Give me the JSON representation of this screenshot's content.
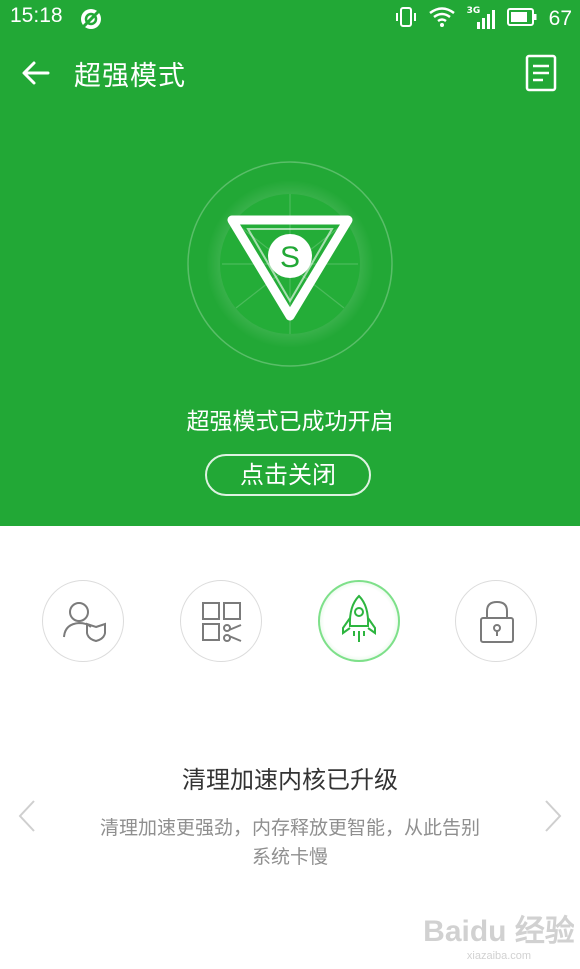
{
  "status_bar": {
    "time": "15:18",
    "network": "3G",
    "battery": "67"
  },
  "header": {
    "title": "超强模式"
  },
  "hero": {
    "logo_letter": "S",
    "status_text": "超强模式已成功开启",
    "close_button_label": "点击关闭"
  },
  "features": [
    {
      "icon": "user-shield-icon",
      "active": false
    },
    {
      "icon": "app-manager-icon",
      "active": false
    },
    {
      "icon": "rocket-icon",
      "active": true
    },
    {
      "icon": "lock-icon",
      "active": false
    }
  ],
  "feature_detail": {
    "headline": "清理加速内核已升级",
    "description": "清理加速更强劲，内存释放更智能，从此告别系统卡慢"
  },
  "watermark": {
    "text": "Baidu 经验",
    "site": "xiazaiba.com"
  },
  "colors": {
    "brand_green": "#22a836",
    "active_ring": "#7ee08a"
  }
}
